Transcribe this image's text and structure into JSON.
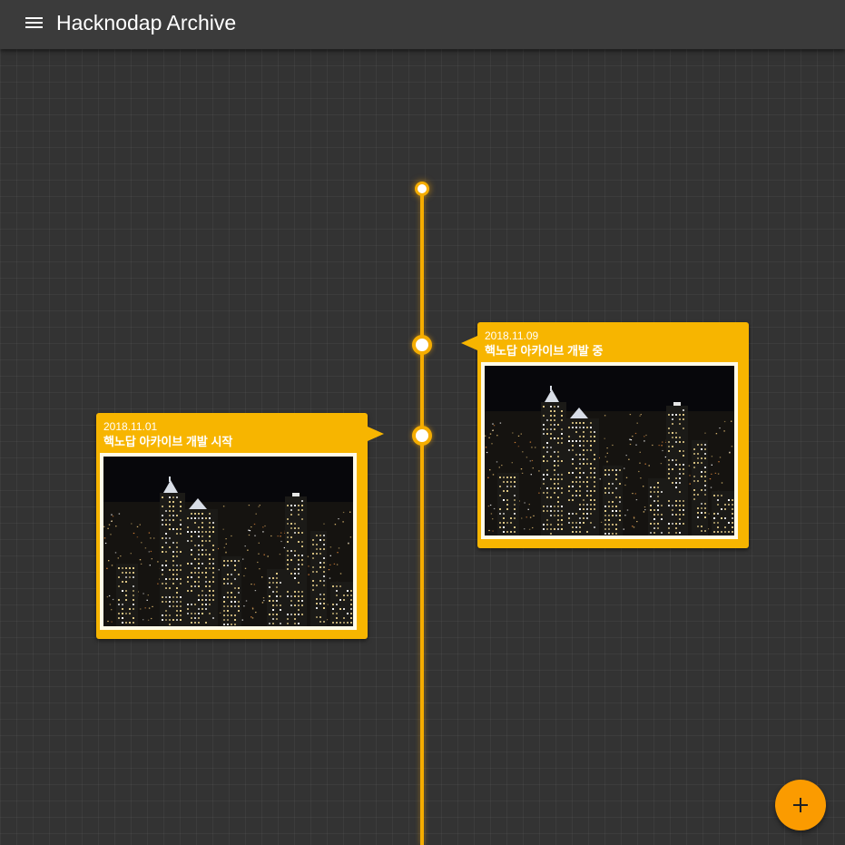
{
  "app": {
    "title": "Hacknodap Archive",
    "accent_color": "#f7b500",
    "fab_color": "#fb9b00",
    "menu_icon": "hamburger-menu-icon",
    "fab_icon": "plus-icon"
  },
  "timeline": {
    "entries": [
      {
        "date": "2018.11.09",
        "title": "핵노답 아카이브 개발 중",
        "photo": "night-city-skyline-photo"
      },
      {
        "date": "2018.11.01",
        "title": "핵노답 아카이브 개발 시작",
        "photo": "night-city-skyline-photo"
      }
    ]
  }
}
